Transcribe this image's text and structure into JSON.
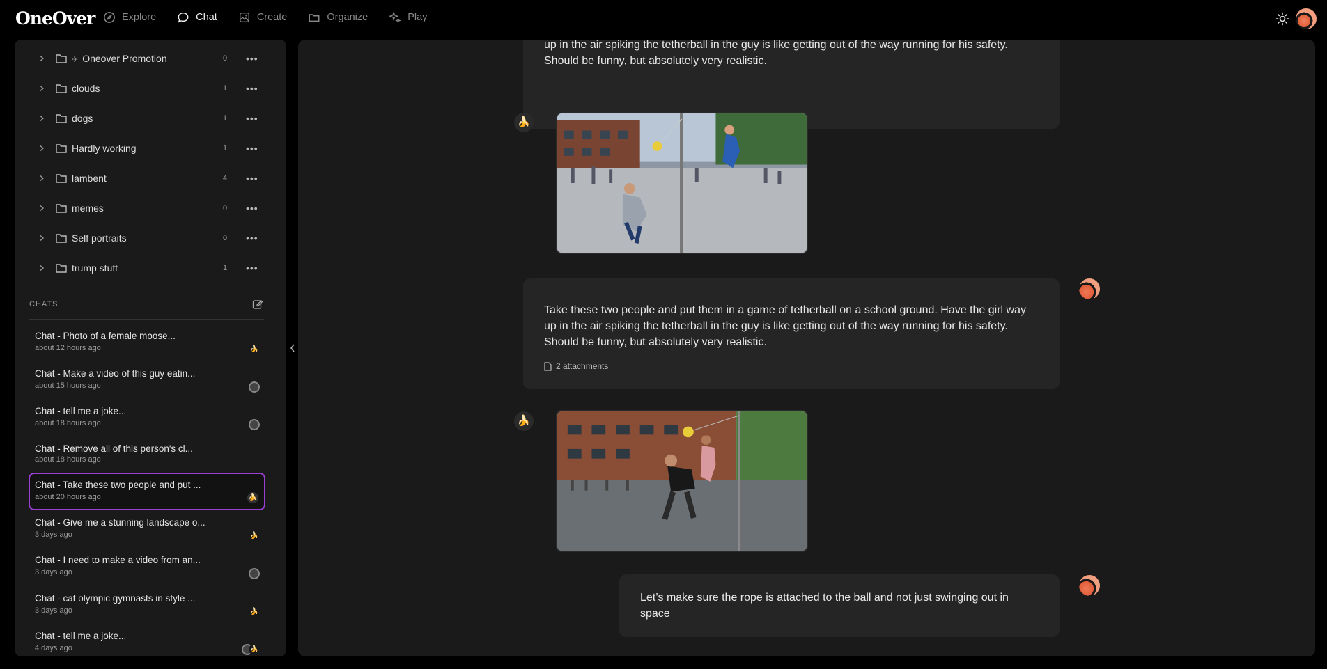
{
  "app": {
    "logo": "OneOver"
  },
  "nav": {
    "items": [
      {
        "label": "Explore",
        "icon": "compass-icon",
        "active": false
      },
      {
        "label": "Chat",
        "icon": "chat-bubble-icon",
        "active": true
      },
      {
        "label": "Create",
        "icon": "image-icon",
        "active": false
      },
      {
        "label": "Organize",
        "icon": "folder-icon",
        "active": false
      },
      {
        "label": "Play",
        "icon": "sparkle-icon",
        "active": false
      }
    ]
  },
  "folders": [
    {
      "name": "Oneover Promotion",
      "count": "0",
      "pinned": true
    },
    {
      "name": "clouds",
      "count": "1"
    },
    {
      "name": "dogs",
      "count": "1"
    },
    {
      "name": "Hardly working",
      "count": "1"
    },
    {
      "name": "lambent",
      "count": "4"
    },
    {
      "name": "memes",
      "count": "0"
    },
    {
      "name": "Self portraits",
      "count": "0"
    },
    {
      "name": "trump stuff",
      "count": "1"
    }
  ],
  "chats_section": {
    "label": "CHATS"
  },
  "chats": [
    {
      "title": "Chat - Photo of a female moose...",
      "time": "about 12 hours ago",
      "icon": "banana"
    },
    {
      "title": "Chat - Make a video of this guy eatin...",
      "time": "about 15 hours ago",
      "icon": "gear"
    },
    {
      "title": "Chat - tell me a joke...",
      "time": "about 18 hours ago",
      "icon": "gear"
    },
    {
      "title": "Chat - Remove all of this person's cl...",
      "time": "about 18 hours ago",
      "icon": ""
    },
    {
      "title": "Chat - Take these two people and put ...",
      "time": "about 20 hours ago",
      "icon": "banana",
      "selected": true
    },
    {
      "title": "Chat - Give me a stunning landscape o...",
      "time": "3 days ago",
      "icon": "banana"
    },
    {
      "title": "Chat - I need to make a video from an...",
      "time": "3 days ago",
      "icon": "gear"
    },
    {
      "title": "Chat - cat olympic gymnasts in style ...",
      "time": "3 days ago",
      "icon": "banana"
    },
    {
      "title": "Chat - tell me a joke...",
      "time": "4 days ago",
      "icon": "gear-banana"
    }
  ],
  "messages": {
    "top_partial": {
      "lines": [
        "up in the air spiking the tetherball in the guy is like getting out of the way running for his safety.",
        "Should be funny, but absolutely very realistic."
      ]
    },
    "user_message": {
      "lines": [
        "Take these two people and put them in a game of tetherball on a school ground. Have the girl way",
        "up in the air spiking the tetherball in the guy is like getting out of the way running for his safety.",
        "Should be funny, but absolutely very realistic."
      ],
      "attachments": "2 attachments"
    },
    "last_message": "Let’s make sure the rope is attached to the ball and not just swinging out in space"
  },
  "colors": {
    "accent": "#9b3fd3",
    "banana": "#e8c040"
  }
}
